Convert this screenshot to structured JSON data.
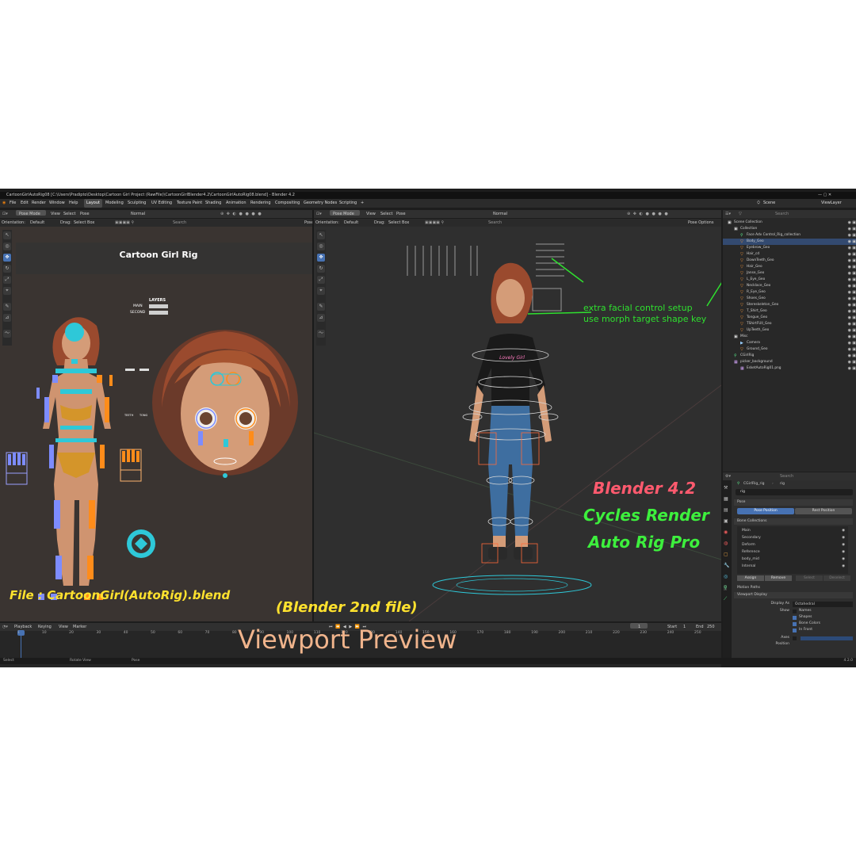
{
  "window": {
    "title": "CartoonGirlAutoRig08 [C:\\Users\\Pradipto\\Desktop\\Cartoon Girl Project (RawFile)\\CartoonGirlBlender4.2\\CartoonGirlAutoRig08.blend] - Blender 4.2",
    "controls": "—  ▢  ✕"
  },
  "menu": {
    "items": [
      "File",
      "Edit",
      "Render",
      "Window",
      "Help"
    ],
    "workspaces": [
      "Layout",
      "Modeling",
      "Sculpting",
      "UV Editing",
      "Texture Paint",
      "Shading",
      "Animation",
      "Rendering",
      "Compositing",
      "Geometry Nodes",
      "Scripting",
      "+"
    ],
    "active_workspace": "Layout",
    "scene": "Scene",
    "view_layer": "ViewLayer"
  },
  "left_viewport": {
    "mode": "Pose Mode",
    "menus": [
      "View",
      "Select",
      "Pose"
    ],
    "shading": "Normal",
    "orientation_label": "Orientation:",
    "orientation": "Default",
    "drag_label": "Drag:",
    "drag": "Select Box",
    "search_placeholder": "Search",
    "pose_options": "Pose",
    "picker_title": "Cartoon Girl Rig",
    "layers_title": "LAYERS",
    "layer_main": "MAIN",
    "layer_second": "SECOND",
    "teeth_label": "TEETH",
    "tong_label": "TONG",
    "file_caption": "File : CartoonGirl(AutoRig).blend"
  },
  "right_viewport": {
    "mode": "Pose Mode",
    "menus": [
      "View",
      "Select",
      "Pose"
    ],
    "shading": "Normal",
    "orientation_label": "Orientation:",
    "orientation": "Default",
    "drag_label": "Drag:",
    "drag": "Select Box",
    "search_placeholder": "Search",
    "pose_options": "Pose Options",
    "annotation_line1": "extra facial control setup",
    "annotation_line2": "use morph target shape key",
    "shirt_text": "Lovely Girl",
    "promo_line1": "Blender 4.2",
    "promo_line2": "Cycles Render",
    "promo_line3": "Auto Rig Pro",
    "second_file": "(Blender 2nd file)",
    "viewport_preview": "Viewport Preview"
  },
  "outliner": {
    "search_placeholder": "Search",
    "items": [
      {
        "label": "Scene Collection",
        "indent": 0,
        "kind": "collection"
      },
      {
        "label": "Collection",
        "indent": 1,
        "kind": "collection"
      },
      {
        "label": "Face Adv Control_Rig_collection",
        "indent": 2,
        "kind": "armature"
      },
      {
        "label": "Body_Geo",
        "indent": 2,
        "kind": "mesh"
      },
      {
        "label": "Eyebrow_Geo",
        "indent": 2,
        "kind": "mesh"
      },
      {
        "label": "Hair_cd",
        "indent": 2,
        "kind": "mesh"
      },
      {
        "label": "DownTeeth_Geo",
        "indent": 2,
        "kind": "mesh"
      },
      {
        "label": "Hair_Geo",
        "indent": 2,
        "kind": "mesh"
      },
      {
        "label": "Janse_Geo",
        "indent": 2,
        "kind": "mesh"
      },
      {
        "label": "L_Eye_Geo",
        "indent": 2,
        "kind": "mesh"
      },
      {
        "label": "Necklace_Geo",
        "indent": 2,
        "kind": "mesh"
      },
      {
        "label": "R_Eye_Geo",
        "indent": 2,
        "kind": "mesh"
      },
      {
        "label": "Shoes_Geo",
        "indent": 2,
        "kind": "mesh"
      },
      {
        "label": "Stereskeleton_Geo",
        "indent": 2,
        "kind": "mesh"
      },
      {
        "label": "T_Shirt_Geo",
        "indent": 2,
        "kind": "mesh"
      },
      {
        "label": "Tongue_Geo",
        "indent": 2,
        "kind": "mesh"
      },
      {
        "label": "TShirtFUll_Geo",
        "indent": 2,
        "kind": "mesh"
      },
      {
        "label": "UpTeeth_Geo",
        "indent": 2,
        "kind": "mesh"
      },
      {
        "label": "Misc",
        "indent": 1,
        "kind": "collection"
      },
      {
        "label": "Camera",
        "indent": 2,
        "kind": "camera"
      },
      {
        "label": "Ground_Geo",
        "indent": 2,
        "kind": "mesh"
      },
      {
        "label": "CGirlRig",
        "indent": 1,
        "kind": "armature"
      },
      {
        "label": "picker_background",
        "indent": 1,
        "kind": "image"
      },
      {
        "label": "EsketAutoRig01.png",
        "indent": 2,
        "kind": "image"
      }
    ]
  },
  "properties": {
    "search_placeholder": "Search",
    "breadcrumb_object": "CGirlRig_rig",
    "breadcrumb_data": "rig",
    "data_name": "rig",
    "pose_section": "Pose",
    "pose_position": "Pose Position",
    "rest_position": "Rest Position",
    "bone_collections_section": "Bone Collections",
    "bone_collections": [
      "Main",
      "Secondary",
      "Deform",
      "Reference",
      "body_mid",
      "Internal"
    ],
    "assign": "Assign",
    "remove": "Remove",
    "select": "Select",
    "deselect": "Deselect",
    "motion_paths": "Motion Paths",
    "viewport_display": "Viewport Display",
    "display_as_label": "Display As",
    "display_as": "Octahedral",
    "show_label": "Show",
    "show_names": "Names",
    "show_shapes": "Shapes",
    "show_bone_colors": "Bone Colors",
    "show_in_front": "In Front",
    "axes_label": "Axes",
    "position_label": "Position"
  },
  "timeline": {
    "menus": [
      "Playback",
      "Keying",
      "View",
      "Marker"
    ],
    "current_frame": "1",
    "start_label": "Start",
    "start": "1",
    "end_label": "End",
    "end": "250",
    "ticks": [
      "1",
      "10",
      "20",
      "30",
      "40",
      "50",
      "60",
      "70",
      "80",
      "90",
      "100",
      "110",
      "120",
      "130",
      "140",
      "150",
      "160",
      "170",
      "180",
      "190",
      "200",
      "210",
      "220",
      "230",
      "240",
      "250"
    ]
  },
  "status": {
    "select": "Select",
    "rotate_view": "Rotate View",
    "pose": "Pose",
    "version": "4.2.0"
  },
  "colors": {
    "accent_blue": "#4772b3",
    "promo_red": "#ff5a6e",
    "promo_green": "#3df03d",
    "annotation_green": "#2fe02f",
    "caption_yellow": "#ffe22e",
    "preview_peach": "#f0b48c",
    "control_orange": "#ff8c1a",
    "control_blue": "#7d8cff",
    "control_cyan": "#2ec8d8"
  }
}
